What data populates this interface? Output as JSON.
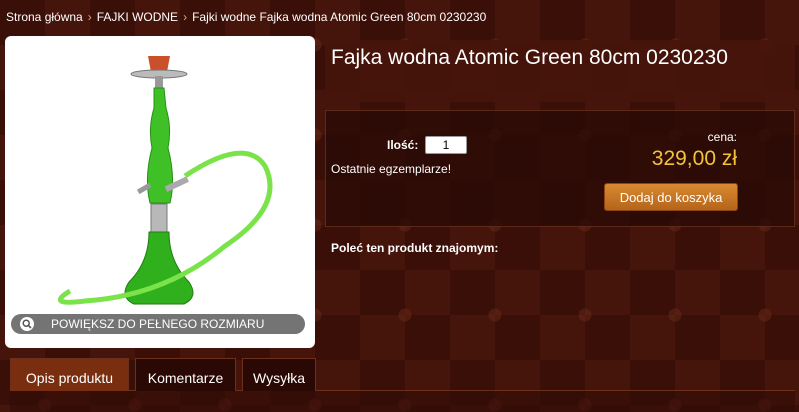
{
  "breadcrumb": {
    "home": "Strona główna",
    "category": "FAJKI WODNE",
    "subcategory": "Fajki wodne",
    "current": "Fajka wodna Atomic Green 80cm 0230230"
  },
  "product": {
    "title": "Fajka wodna Atomic Green 80cm 0230230",
    "zoom_label": "POWIĘKSZ DO PEŁNEGO ROZMIARU",
    "qty_label": "Ilość:",
    "qty_value": "1",
    "stock_note": "Ostatnie egzemplarze!",
    "price_label": "cena:",
    "price": "329,00 zł",
    "add_to_cart": "Dodaj do koszyka",
    "recommend": "Poleć ten produkt znajomym:"
  },
  "tabs": [
    "Opis produktu",
    "Komentarze",
    "Wysyłka"
  ],
  "colors": {
    "accent": "#f3c338",
    "button": "#c8761f",
    "background": "#3a0f08"
  }
}
